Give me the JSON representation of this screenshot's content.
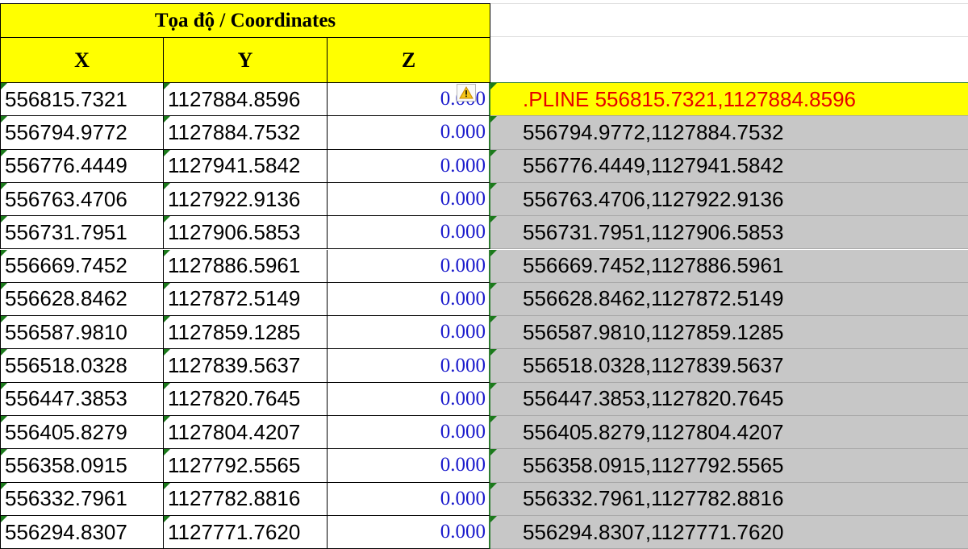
{
  "header": {
    "title": "Tọa độ / Coordinates",
    "col_x": "X",
    "col_y": "Y",
    "col_z": "Z"
  },
  "rows": [
    {
      "x": "556815.7321",
      "y": "1127884.8596",
      "z": "0.000",
      "cmd": ".PLINE 556815.7321,1127884.8596"
    },
    {
      "x": "556794.9772",
      "y": "1127884.7532",
      "z": "0.000",
      "cmd": "556794.9772,1127884.7532"
    },
    {
      "x": "556776.4449",
      "y": "1127941.5842",
      "z": "0.000",
      "cmd": "556776.4449,1127941.5842"
    },
    {
      "x": "556763.4706",
      "y": "1127922.9136",
      "z": "0.000",
      "cmd": "556763.4706,1127922.9136"
    },
    {
      "x": "556731.7951",
      "y": "1127906.5853",
      "z": "0.000",
      "cmd": "556731.7951,1127906.5853"
    },
    {
      "x": "556669.7452",
      "y": "1127886.5961",
      "z": "0.000",
      "cmd": "556669.7452,1127886.5961"
    },
    {
      "x": "556628.8462",
      "y": "1127872.5149",
      "z": "0.000",
      "cmd": "556628.8462,1127872.5149"
    },
    {
      "x": "556587.9810",
      "y": "1127859.1285",
      "z": "0.000",
      "cmd": "556587.9810,1127859.1285"
    },
    {
      "x": "556518.0328",
      "y": "1127839.5637",
      "z": "0.000",
      "cmd": "556518.0328,1127839.5637"
    },
    {
      "x": "556447.3853",
      "y": "1127820.7645",
      "z": "0.000",
      "cmd": "556447.3853,1127820.7645"
    },
    {
      "x": "556405.8279",
      "y": "1127804.4207",
      "z": "0.000",
      "cmd": "556405.8279,1127804.4207"
    },
    {
      "x": "556358.0915",
      "y": "1127792.5565",
      "z": "0.000",
      "cmd": "556358.0915,1127792.5565"
    },
    {
      "x": "556332.7961",
      "y": "1127782.8816",
      "z": "0.000",
      "cmd": "556332.7961,1127782.8816"
    },
    {
      "x": "556294.8307",
      "y": "1127771.7620",
      "z": "0.000",
      "cmd": "556294.8307,1127771.7620"
    }
  ],
  "colors": {
    "header_fill": "#ffff00",
    "command_first_fill": "#ffff00",
    "command_first_text": "#e60000",
    "command_fill": "#c7c7c7",
    "z_text": "#1a1acc",
    "corner_marker": "#1b7a1b"
  },
  "icons": {
    "error_indicator": "warning-icon",
    "cell_marker": "green-triangle-marker"
  }
}
